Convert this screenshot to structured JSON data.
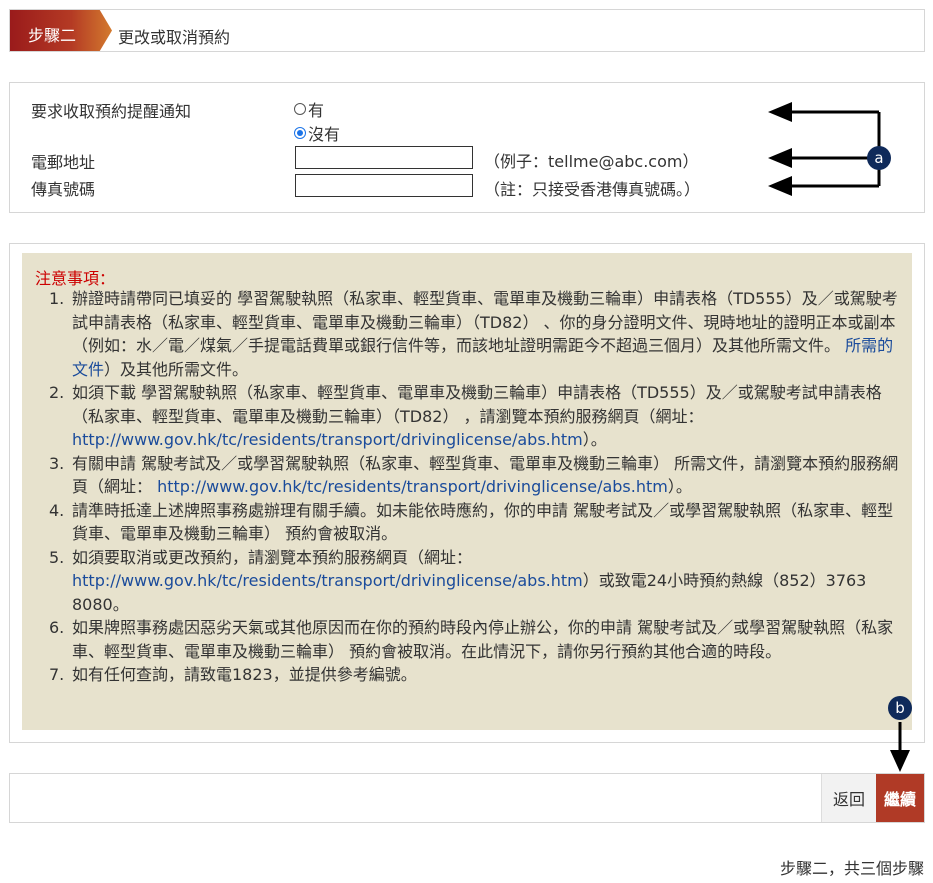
{
  "step": {
    "tab_label": "步驟二",
    "title": "更改或取消預約"
  },
  "form": {
    "reminder_label": "要求收取預約提醒通知",
    "option_yes": "有",
    "option_no": "沒有",
    "email_label": "電郵地址",
    "email_value": "",
    "email_hint": "（例子：tellme@abc.com）",
    "fax_label": "傳真號碼",
    "fax_value": "",
    "fax_hint": "（註：只接受香港傳真號碼。）"
  },
  "notes": {
    "title": "注意事項：",
    "items": [
      {
        "num": "1.",
        "text1": "辦證時請帶同已填妥的 學習駕駛執照（私家車、輕型貨車、電單車及機動三輪車）申請表格（TD555）及／或駕駛考試申請表格（私家車、輕型貨車、電單車及機動三輪車）（TD82） 、你的身分證明文件、現時地址的證明正本或副本（例如：水／電／煤氣／手提電話費單或銀行信件等，而該地址證明需距今不超過三個月）及其他所需文件。",
        "link": "所需的文件",
        "text2": "）及其他所需文件。"
      },
      {
        "num": "2.",
        "text1": "如須下載 學習駕駛執照（私家車、輕型貨車、電單車及機動三輪車）申請表格（TD555）及／或駕駛考試申請表格（私家車、輕型貨車、電單車及機動三輪車）（TD82） ，請瀏覽本預約服務網頁（網址：",
        "link": "http://www.gov.hk/tc/residents/transport/drivinglicense/abs.htm",
        "text2": "）。"
      },
      {
        "num": "3.",
        "text1": "有關申請 駕駛考試及／或學習駕駛執照（私家車、輕型貨車、電單車及機動三輪車） 所需文件，請瀏覽本預約服務網頁（網址：",
        "link": "http://www.gov.hk/tc/residents/transport/drivinglicense/abs.htm",
        "text2": "）。"
      },
      {
        "num": "4.",
        "text1": "請準時抵達上述牌照事務處辦理有關手續。如未能依時應約，你的申請 駕駛考試及／或學習駕駛執照（私家車、輕型貨車、電單車及機動三輪車） 預約會被取消。",
        "link": "",
        "text2": ""
      },
      {
        "num": "5.",
        "text1": "如須要取消或更改預約，請瀏覽本預約服務網頁（網址：",
        "link": "http://www.gov.hk/tc/residents/transport/drivinglicense/abs.htm",
        "text2": "）或致電24小時預約熱線（852）3763 8080。"
      },
      {
        "num": "6.",
        "text1": "如果牌照事務處因惡劣天氣或其他原因而在你的預約時段內停止辦公，你的申請 駕駛考試及／或學習駕駛執照（私家車、輕型貨車、電單車及機動三輪車） 預約會被取消。在此情況下，請你另行預約其他合適的時段。",
        "link": "",
        "text2": ""
      },
      {
        "num": "7.",
        "text1": "如有任何查詢，請致電1823，並提供參考編號。",
        "link": "",
        "text2": ""
      }
    ]
  },
  "actions": {
    "back_label": "返回",
    "continue_label": "繼續"
  },
  "footer": {
    "step_indicator": "步驟二，共三個步驟"
  },
  "annotations": {
    "marker_a": "a",
    "marker_b": "b"
  },
  "colors": {
    "accent": "#b03a26",
    "notes_bg": "#e7e2cd",
    "link": "#1a4b9b",
    "notes_title": "#cc0000"
  }
}
